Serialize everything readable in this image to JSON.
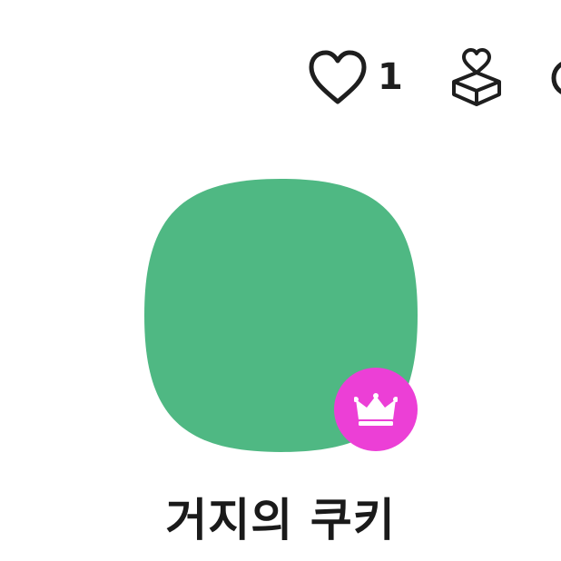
{
  "header": {
    "like": {
      "icon": "heart-outline-icon",
      "count": "1"
    },
    "gift": {
      "icon": "gift-box-heart-icon"
    },
    "more": {
      "icon": "more-circle-icon"
    }
  },
  "profile": {
    "avatar_color": "#4fb883",
    "badge": {
      "icon": "crown-icon",
      "color": "#ec3fd6"
    },
    "name": "거지의 쿠키"
  }
}
